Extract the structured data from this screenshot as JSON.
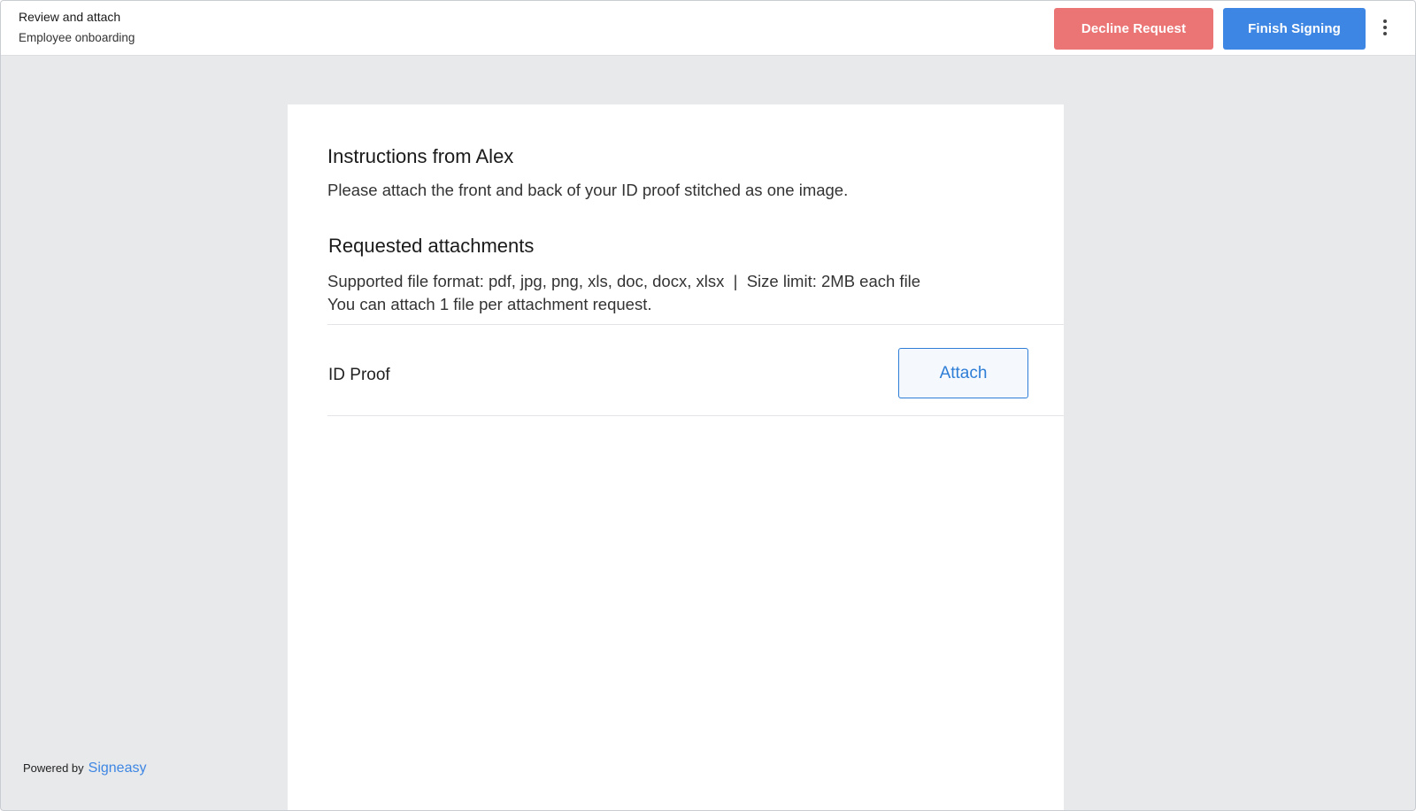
{
  "header": {
    "title": "Review and attach",
    "document_name": "Employee onboarding",
    "decline_label": "Decline Request",
    "finish_label": "Finish Signing",
    "more_icon": "kebab-vertical-icon"
  },
  "colors": {
    "decline": "#eb7475",
    "finish": "#3d86e3",
    "background": "#e8e9eb",
    "accent": "#2e7dd6"
  },
  "instructions": {
    "title": "Instructions from Alex",
    "text": "Please attach the front and back of your ID proof stitched as one image."
  },
  "requested_attachments": {
    "title": "Requested attachments",
    "format_text": "Supported file format: pdf, jpg, png, xls, doc, docx, xlsx  |  Size limit: 2MB each file",
    "limit_text": "You can attach 1 file per attachment request.",
    "items": [
      {
        "label": "ID Proof",
        "action_label": "Attach"
      }
    ]
  },
  "footer": {
    "powered_by": "Powered by",
    "brand": "Signeasy"
  }
}
